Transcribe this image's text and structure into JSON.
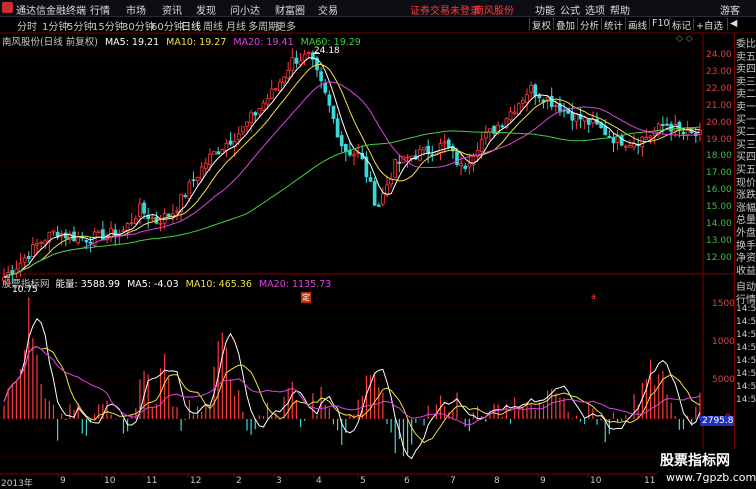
{
  "titlebar": {
    "app_name": "通达信金融终端",
    "menus": [
      "行情",
      "市场",
      "资讯",
      "发现",
      "问小达",
      "财富圈",
      "交易"
    ],
    "warning": "证券交易未登录",
    "stock_name": "南风股份",
    "right_items": [
      "功能",
      "公式",
      "选项",
      "帮助"
    ],
    "user": "游客"
  },
  "toolbar": {
    "periods": [
      "分时",
      "1分钟",
      "5分钟",
      "15分钟",
      "30分钟",
      "60分钟",
      "日线",
      "周线",
      "月线",
      "多周期",
      "更多"
    ],
    "active_period": "日线",
    "right_buttons": [
      "复权",
      "叠加",
      "分析",
      "统计",
      "画线",
      "F10",
      "标记",
      "+自选",
      "◀"
    ]
  },
  "price_legend": {
    "title": "南风股份(日线 前复权)",
    "ma5": "MA5: 19.21",
    "ma10": "MA10: 19.27",
    "ma20": "MA20: 19.41",
    "ma60": "MA60: 19.29",
    "colors": {
      "ma5": "#ffffff",
      "ma10": "#f0e040",
      "ma20": "#e040e0",
      "ma60": "#40d040"
    }
  },
  "price_annotations": {
    "high": "24.18",
    "low": "10.75",
    "event_mark": "定",
    "event_mark2": "a"
  },
  "price_axis": [
    "24.00",
    "23.00",
    "22.00",
    "21.00",
    "20.00",
    "19.00",
    "18.00",
    "17.00",
    "16.00",
    "15.00",
    "14.00",
    "13.00",
    "12.00"
  ],
  "indicator_legend": {
    "name": "股票指标网",
    "title": "能量: 3588.99",
    "ma5": "MA5: -4.03",
    "ma10": "MA10: 465.36",
    "ma20": "MA20: 1135.73"
  },
  "indicator_axis": [
    "15000",
    "10000",
    "5000",
    "0",
    "-5000"
  ],
  "indicator_current": "2795.81",
  "x_axis": [
    {
      "label": "2013年"
    },
    {
      "label": "9"
    },
    {
      "label": "10"
    },
    {
      "label": "11"
    },
    {
      "label": "12"
    },
    {
      "label": "2"
    },
    {
      "label": "3"
    },
    {
      "label": "4"
    },
    {
      "label": "5"
    },
    {
      "label": "6"
    },
    {
      "label": "7"
    },
    {
      "label": "8"
    },
    {
      "label": "9"
    },
    {
      "label": "10"
    },
    {
      "label": "11"
    }
  ],
  "right_panel": [
    "委比",
    "卖五",
    "卖四",
    "卖三",
    "卖二",
    "卖一",
    "买一",
    "买二",
    "买三",
    "买四",
    "买五",
    "现价",
    "涨跌",
    "涨幅",
    "总量",
    "外盘",
    "换手",
    "净资",
    "收益",
    "自动",
    "行情",
    "14:50",
    "14:50",
    "14:50",
    "14:50",
    "14:50",
    "14:50",
    "14:50",
    "14:50"
  ],
  "watermark": {
    "line1": "股票指标网",
    "line2": "www.7gpzb.com"
  },
  "chart_data": [
    {
      "type": "candlestick",
      "title": "南风股份(日线 前复权)",
      "y_range": [
        11.2,
        24.5
      ],
      "series": [
        {
          "name": "MA5"
        },
        {
          "name": "MA10"
        },
        {
          "name": "MA20"
        },
        {
          "name": "MA60"
        }
      ],
      "close_path": [
        10.9,
        11.8,
        12.9,
        13.6,
        13.3,
        13.2,
        13.4,
        13.6,
        14.9,
        14.2,
        14.8,
        16.4,
        17.9,
        18.8,
        19.6,
        20.9,
        22.1,
        23.8,
        24.0,
        21.5,
        18.5,
        18.1,
        15.0,
        17.5,
        18.1,
        18.4,
        18.8,
        17.3,
        18.9,
        19.8,
        20.9,
        22.1,
        21.5,
        20.8,
        20.3,
        19.8,
        19.1,
        18.9,
        19.3,
        20.0,
        19.4,
        19.3
      ]
    },
    {
      "type": "bar",
      "title": "能量: 3588.99",
      "y_range": [
        -7000,
        17000
      ],
      "series": [
        {
          "name": "能量",
          "values": [
            2000,
            9000,
            15000,
            6000,
            -2000,
            5000,
            -3000,
            4000,
            1000,
            -2500,
            6000,
            2000,
            9000,
            -1500,
            3000,
            1500,
            14000,
            5000,
            -3000,
            2000,
            1000,
            4000,
            -2000,
            5000,
            1000,
            -4000,
            3000,
            6000,
            2000,
            -6000,
            -3000,
            1000,
            2500,
            3000,
            -1000,
            2000,
            1000,
            500,
            3000,
            800,
            5000,
            3000,
            -1500,
            2000,
            -3500,
            1200,
            2500,
            4000,
            9000,
            1000,
            -2000,
            3600
          ]
        },
        {
          "name": "MA5",
          "values": [
            -4.03
          ]
        },
        {
          "name": "MA10",
          "values": [
            465.36
          ]
        },
        {
          "name": "MA20",
          "values": [
            1135.73
          ]
        }
      ]
    }
  ]
}
